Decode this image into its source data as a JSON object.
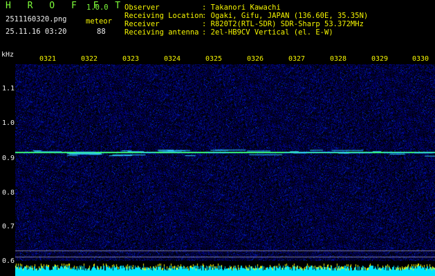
{
  "app": {
    "name": "H R O F F T",
    "version": "1.0.0",
    "filename": "2511160320.png",
    "datetime": "25.11.16 03:20",
    "mode_label": "meteor",
    "count": "88"
  },
  "info": {
    "rows": [
      {
        "key": "Observer",
        "value": ": Takanori Kawachi"
      },
      {
        "key": "Receiving Location",
        "value": ": Ogaki, Gifu, JAPAN (136.60E, 35.35N)"
      },
      {
        "key": "Receiver",
        "value": ": R820T2(RTL-SDR) SDR-Sharp 53.372MHz"
      },
      {
        "key": "Receiving antenna",
        "value": ": 2el-HB9CV Vertical (el. E-W)"
      }
    ]
  },
  "axis": {
    "unit": "kHz",
    "freq_labels": [
      "1.1",
      "1.0",
      "0.9",
      "0.8",
      "0.7",
      "0.6"
    ],
    "time_labels": [
      "0321",
      "0322",
      "0323",
      "0324",
      "0325",
      "0326",
      "0327",
      "0328",
      "0329",
      "0330"
    ]
  },
  "colors": {
    "background": "#000000",
    "spectrum_base": "#0a0a5a",
    "carrier": "#39ff7a",
    "title_green": "#7fff3a",
    "label_yellow": "#f6f600",
    "level_bar": "#00e5ff"
  }
}
